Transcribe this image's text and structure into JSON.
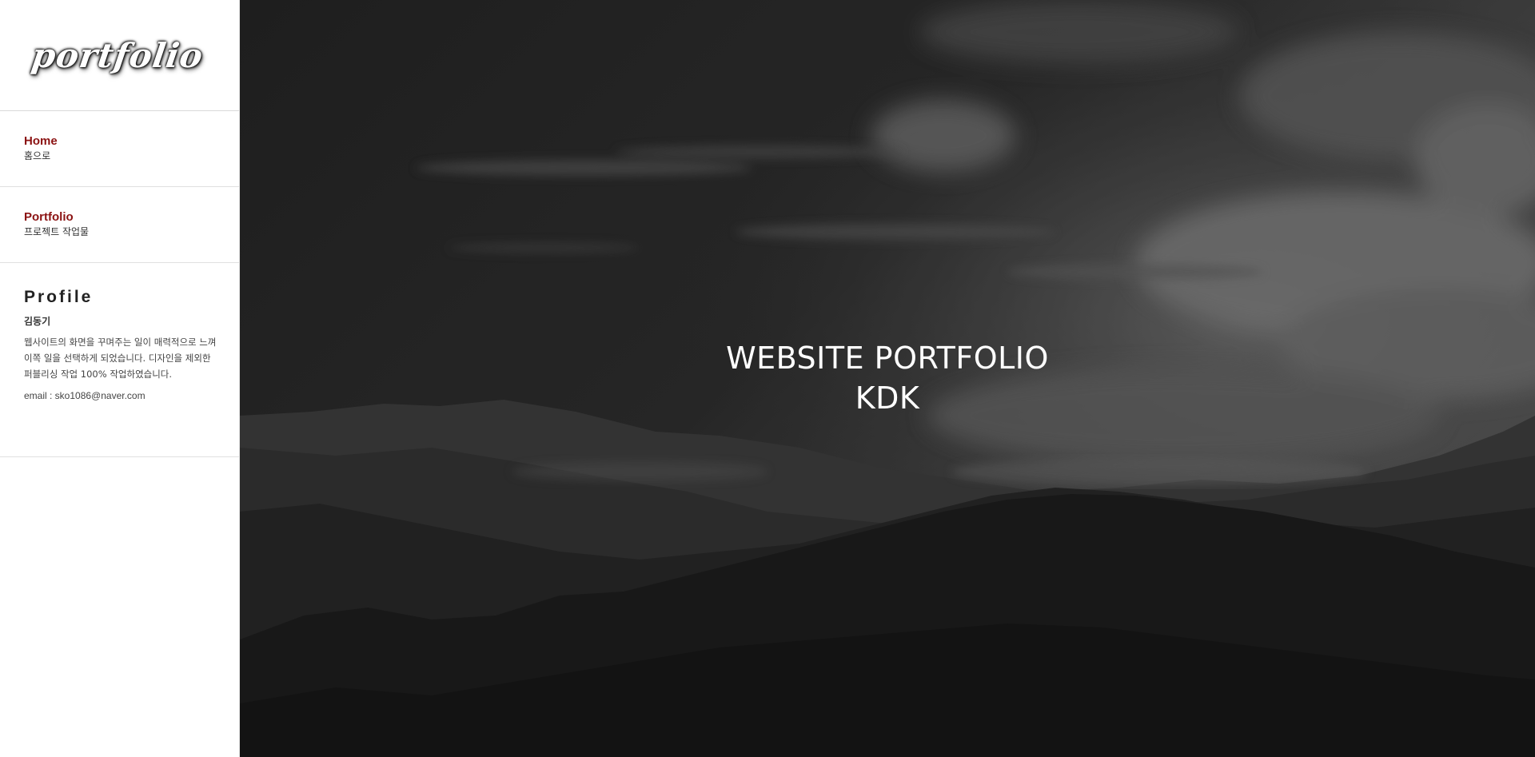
{
  "logo": {
    "text": "portfolio"
  },
  "nav": {
    "items": [
      {
        "title": "Home",
        "sub": "홈으로"
      },
      {
        "title": "Portfolio",
        "sub": "프로젝트 작업물"
      }
    ]
  },
  "profile": {
    "heading": "Profile",
    "name": "김동기",
    "description": "웹사이트의 화면을 꾸며주는 일이 매력적으로 느껴 이쪽 일을 선택하게 되었습니다. 디자인을 제외한 퍼블리싱 작업 100% 작업하였습니다.",
    "email": "email : sko1086@naver.com"
  },
  "hero": {
    "line1": "WEBSITE PORTFOLIO",
    "line2": "KDK"
  },
  "colors": {
    "accent": "#8b1212",
    "hero_overlay": "#2b2b2b"
  }
}
